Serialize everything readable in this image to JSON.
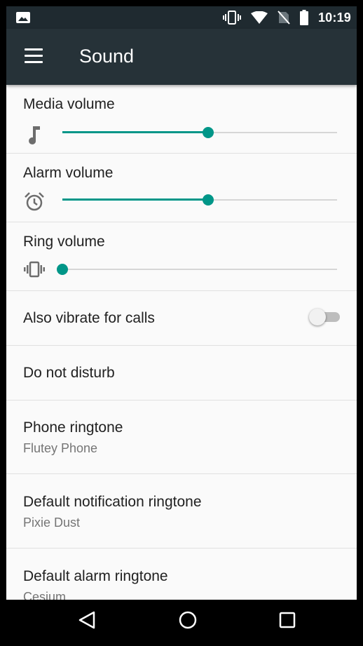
{
  "status_bar": {
    "time": "10:19",
    "icons": [
      "image-icon",
      "vibrate-icon",
      "wifi-icon",
      "no-sim-icon",
      "battery-icon"
    ]
  },
  "app_bar": {
    "title": "Sound",
    "menu_icon": "menu-icon"
  },
  "settings": {
    "media_volume": {
      "label": "Media volume",
      "icon": "music-note-icon",
      "level": 0.53
    },
    "alarm_volume": {
      "label": "Alarm volume",
      "icon": "alarm-clock-icon",
      "level": 0.53
    },
    "ring_volume": {
      "label": "Ring volume",
      "icon": "vibrate-icon",
      "level": 0.0
    },
    "vibrate_calls": {
      "label": "Also vibrate for calls",
      "enabled": false
    },
    "do_not_disturb": {
      "label": "Do not disturb"
    },
    "phone_ringtone": {
      "label": "Phone ringtone",
      "value": "Flutey Phone"
    },
    "notification_ringtone": {
      "label": "Default notification ringtone",
      "value": "Pixie Dust"
    },
    "alarm_ringtone": {
      "label": "Default alarm ringtone",
      "value": "Cesium"
    }
  },
  "nav_bar": {
    "icons": [
      "back-icon",
      "home-icon",
      "recents-icon"
    ]
  },
  "colors": {
    "accent": "#009688",
    "app_bar": "#263238",
    "status_bar": "#1f2a30"
  }
}
